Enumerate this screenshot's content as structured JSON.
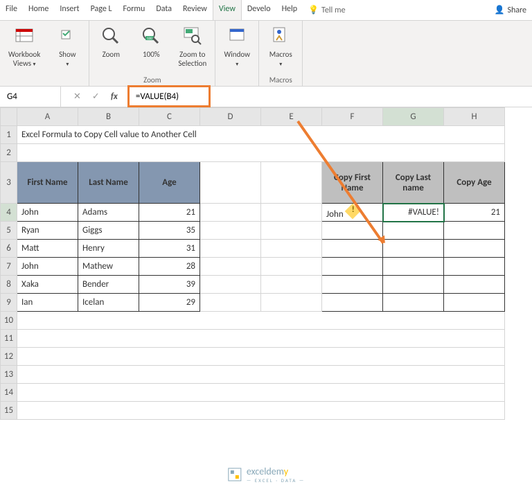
{
  "tabs": {
    "file": "File",
    "home": "Home",
    "insert": "Insert",
    "pagel": "Page L",
    "formu": "Formu",
    "data": "Data",
    "review": "Review",
    "view": "View",
    "develo": "Develo",
    "help": "Help",
    "tellme": "Tell me",
    "share": "Share"
  },
  "ribbon": {
    "views": "Workbook\nViews",
    "show": "Show",
    "zoom": "Zoom",
    "hundred": "100%",
    "zoomsel": "Zoom to\nSelection",
    "window": "Window",
    "macros": "Macros",
    "g_zoom": "Zoom",
    "g_macros": "Macros"
  },
  "fbar": {
    "name": "G4",
    "formula": "=VALUE(B4)"
  },
  "cols": [
    "A",
    "B",
    "C",
    "D",
    "E",
    "F",
    "G",
    "H"
  ],
  "rows": [
    "1",
    "2",
    "3",
    "4",
    "5",
    "6",
    "7",
    "8",
    "9",
    "10",
    "11",
    "12",
    "13",
    "14",
    "15"
  ],
  "title": "Excel Formula to Copy Cell value to Another Cell",
  "head1": {
    "a": "First Name",
    "b": "Last Name",
    "c": "Age"
  },
  "data1": [
    {
      "a": "John",
      "b": "Adams",
      "c": "21"
    },
    {
      "a": "Ryan",
      "b": "Giggs",
      "c": "35"
    },
    {
      "a": "Matt",
      "b": "Henry",
      "c": "31"
    },
    {
      "a": "John",
      "b": "Mathew",
      "c": "28"
    },
    {
      "a": "Xaka",
      "b": "Bender",
      "c": "39"
    },
    {
      "a": "Ian",
      "b": "Icelan",
      "c": "29"
    }
  ],
  "head2": {
    "f": "Copy First Name",
    "g": "Copy Last name",
    "h": "Copy Age"
  },
  "data2": {
    "f": "John",
    "g": "#VALUE!",
    "h": "21"
  },
  "brand": {
    "name": "exceldem",
    "y": "y",
    "sub": "— EXCEL · DATA —"
  },
  "chart_data": null
}
